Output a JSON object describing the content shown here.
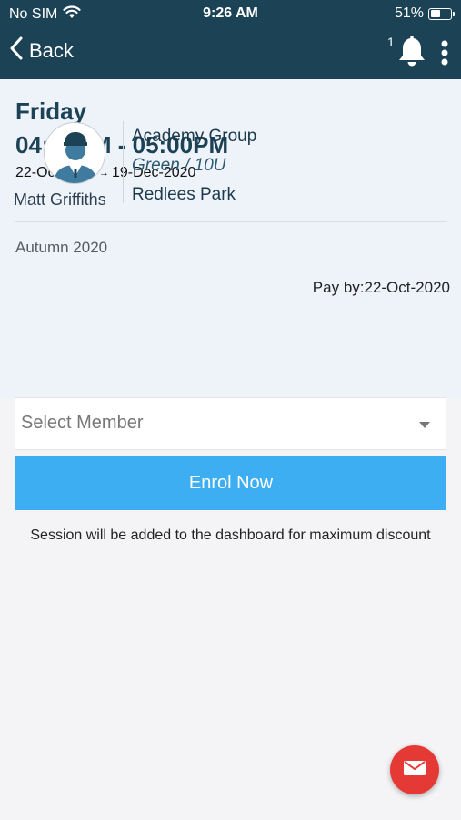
{
  "status_bar": {
    "carrier": "No SIM",
    "time": "9:26 AM",
    "battery": "51%",
    "battery_level": 0.51
  },
  "nav": {
    "back_label": "Back",
    "notification_count": "1"
  },
  "session": {
    "day": "Friday",
    "time_range": "04:00PM - 05:00PM",
    "start_date": "22-Oct-2020",
    "end_date": "19-Dec-2020",
    "coach_name": "Matt Griffiths",
    "group": "Academy Group",
    "level": "Green / 10U",
    "venue": "Redlees Park",
    "term": "Autumn 2020",
    "pay_by": "Pay by:22-Oct-2020"
  },
  "form": {
    "member_placeholder": "Select Member",
    "enrol_label": "Enrol Now",
    "note": "Session will be added to the dashboard for maximum discount"
  },
  "colors": {
    "header": "#1c4256",
    "accent": "#3daef2",
    "fab": "#e53935"
  }
}
